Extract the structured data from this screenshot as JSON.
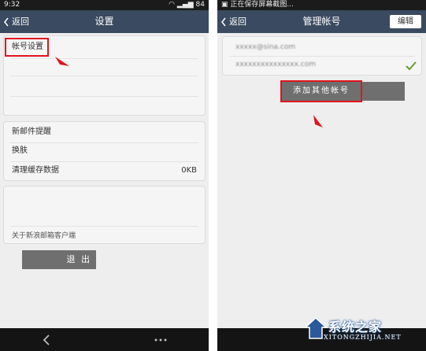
{
  "left_screen": {
    "status_bar": {
      "time": "9:32",
      "battery": "84"
    },
    "title_bar": {
      "back_label": "返回",
      "title": "设置"
    },
    "group1": {
      "rows": [
        {
          "label": "帐号设置"
        },
        {
          "label": ""
        },
        {
          "label": ""
        },
        {
          "label": ""
        }
      ]
    },
    "group2": {
      "rows": [
        {
          "label": "新邮件提醒",
          "value": ""
        },
        {
          "label": "换肤",
          "value": ""
        },
        {
          "label": "清理缓存数据",
          "value": "0KB"
        }
      ]
    },
    "group3": {
      "rows": [
        {
          "label": ""
        },
        {
          "label": "关于新浪邮箱客户端"
        }
      ]
    },
    "logout_label": "退 出"
  },
  "right_screen": {
    "status_bar": {
      "notice": "正在保存屏幕截图..."
    },
    "title_bar": {
      "back_label": "返回",
      "title": "管理帐号",
      "edit_label": "编辑"
    },
    "accounts": [
      {
        "email": "xxxxx@sina.com"
      },
      {
        "email": "xxxxxxxxxxxxxxx.com",
        "selected": true
      }
    ],
    "add_account_label": "添加其他帐号"
  },
  "colors": {
    "title_bar": "#3a4a60",
    "highlight": "#e0141e",
    "button_gray": "#6f6f6f",
    "check_green": "#6a9a2a"
  },
  "watermark": {
    "text": "系统之家",
    "url": "XITONGZHIJIA.NET"
  }
}
